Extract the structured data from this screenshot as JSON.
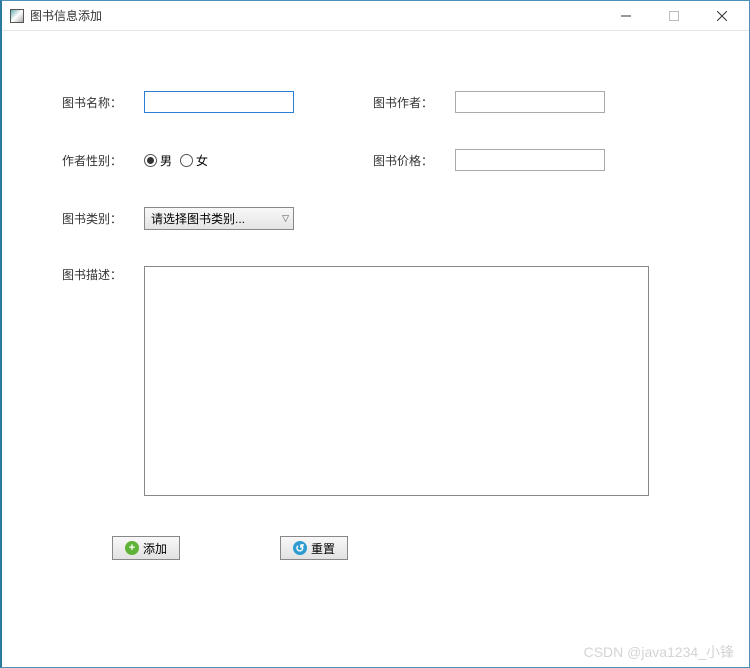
{
  "window": {
    "title": "图书信息添加"
  },
  "labels": {
    "name": "图书名称：",
    "author": "图书作者：",
    "gender": "作者性别：",
    "price": "图书价格：",
    "category": "图书类别：",
    "description": "图书描述："
  },
  "gender": {
    "male": "男",
    "female": "女",
    "selected": "male"
  },
  "category": {
    "placeholder": "请选择图书类别..."
  },
  "values": {
    "name": "",
    "author": "",
    "price": "",
    "description": ""
  },
  "buttons": {
    "add": "添加",
    "reset": "重置"
  },
  "watermark": "CSDN @java1234_小锋"
}
